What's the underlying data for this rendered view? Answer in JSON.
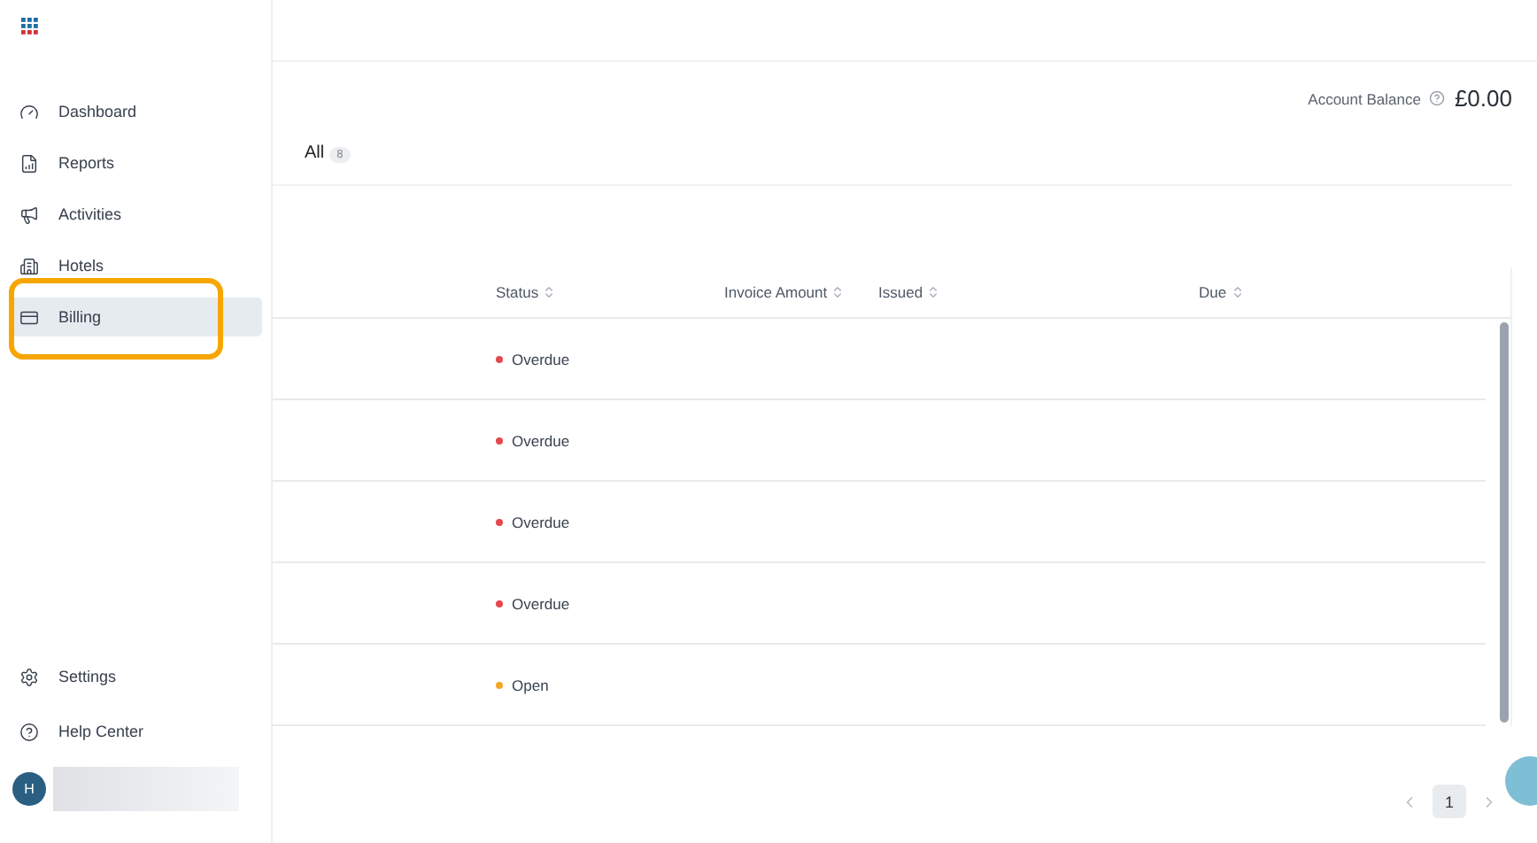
{
  "sidebar": {
    "items": [
      {
        "label": "Dashboard",
        "selected": false
      },
      {
        "label": "Reports",
        "selected": false
      },
      {
        "label": "Activities",
        "selected": false
      },
      {
        "label": "Hotels",
        "selected": false
      },
      {
        "label": "Billing",
        "selected": true
      }
    ],
    "footer_items": [
      {
        "label": "Settings"
      },
      {
        "label": "Help Center"
      }
    ],
    "user": {
      "initial": "H"
    }
  },
  "account_balance": {
    "label": "Account Balance",
    "value": "£0.00"
  },
  "tabs": [
    {
      "label": "All",
      "count": "8",
      "selected": true
    }
  ],
  "table": {
    "columns": [
      "Status",
      "Invoice Amount",
      "Issued",
      "Due"
    ],
    "rows": [
      {
        "status": "Overdue",
        "color": "#e5484d"
      },
      {
        "status": "Overdue",
        "color": "#e5484d"
      },
      {
        "status": "Overdue",
        "color": "#e5484d"
      },
      {
        "status": "Overdue",
        "color": "#e5484d"
      },
      {
        "status": "Open",
        "color": "#f5a623"
      }
    ]
  },
  "pagination": {
    "pages": [
      {
        "label": "1",
        "selected": true
      }
    ]
  }
}
